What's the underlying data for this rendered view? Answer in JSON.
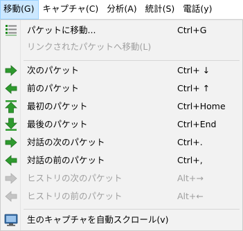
{
  "menubar": {
    "items": [
      {
        "label": "移動(G)"
      },
      {
        "label": "キャプチャ(C)"
      },
      {
        "label": "分析(A)"
      },
      {
        "label": "統計(S)"
      },
      {
        "label": "電話(y)"
      }
    ]
  },
  "menu": {
    "items": [
      {
        "label": "パケットに移動...",
        "shortcut": "Ctrl+G",
        "icon": "goto-packet-icon",
        "enabled": true
      },
      {
        "label": "リンクされたパケットへ移動(L)",
        "shortcut": "",
        "icon": "",
        "enabled": false
      },
      {
        "label": "次のパケット",
        "shortcut": "Ctrl+ ↓",
        "icon": "arrow-right-icon",
        "enabled": true
      },
      {
        "label": "前のパケット",
        "shortcut": "Ctrl+ ↑",
        "icon": "arrow-left-icon",
        "enabled": true
      },
      {
        "label": "最初のパケット",
        "shortcut": "Ctrl+Home",
        "icon": "arrow-up-bar-icon",
        "enabled": true
      },
      {
        "label": "最後のパケット",
        "shortcut": "Ctrl+End",
        "icon": "arrow-down-bar-icon",
        "enabled": true
      },
      {
        "label": "対話の次のパケット",
        "shortcut": "Ctrl+.",
        "icon": "conversation-next-icon",
        "enabled": true
      },
      {
        "label": "対話の前のパケット",
        "shortcut": "Ctrl+,",
        "icon": "conversation-prev-icon",
        "enabled": true
      },
      {
        "label": "ヒストリの次のパケット",
        "shortcut": "Alt+→",
        "icon": "history-next-icon",
        "enabled": false
      },
      {
        "label": "ヒストリの前のパケット",
        "shortcut": "Alt+←",
        "icon": "history-prev-icon",
        "enabled": false
      },
      {
        "label": "生のキャプチャを自動スクロール(v)",
        "shortcut": "",
        "icon": "monitor-icon",
        "enabled": true
      }
    ]
  },
  "colors": {
    "arrow_green": "#2e9a2e",
    "arrow_disabled": "#b8b8b8",
    "active_highlight": "#cce8ff"
  }
}
